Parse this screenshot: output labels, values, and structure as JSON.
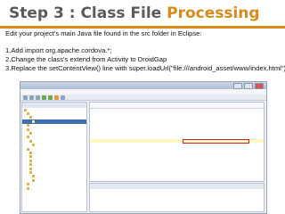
{
  "slide": {
    "title_part1": "Step 3 : Class File ",
    "title_part2": "Processing",
    "intro": "Edit your project's main Java file found in the src folder in Eclipse:",
    "steps": [
      "1.Add import org.apache.cordova.*;",
      "2.Change the class's extend from Activity to DroidGap",
      "3.Replace the setContentView() line with super.loadUrl(\"file:///android_asset/www/index.html\");"
    ]
  },
  "colors": {
    "title_gray": "#5a5a5a",
    "accent_orange": "#d98a1a",
    "highlight_red": "#d32020"
  }
}
